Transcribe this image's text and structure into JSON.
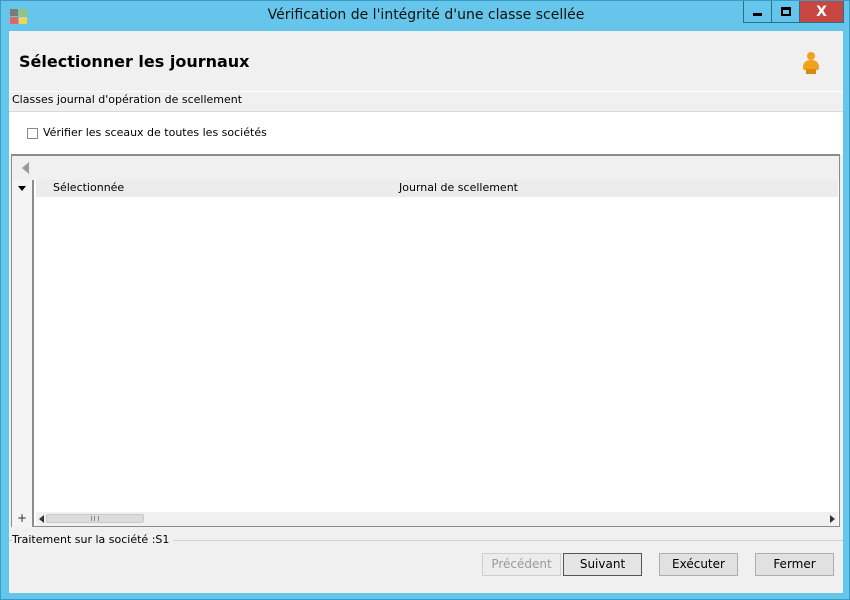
{
  "window": {
    "title": "Vérification de l'intégrité d'une classe scellée",
    "close_glyph": "X"
  },
  "header": {
    "title": "Sélectionner les journaux"
  },
  "group": {
    "label": "Classes journal d'opération de scellement"
  },
  "options": {
    "verify_all_label": "Vérifier les sceaux de toutes les sociétés",
    "verify_all_checked": false
  },
  "grid": {
    "columns": [
      "Sélectionnée",
      "Journal de scellement"
    ],
    "rows": [],
    "add_glyph": "+"
  },
  "status": {
    "text": "Traitement sur la société :S1"
  },
  "buttons": {
    "previous": "Précédent",
    "next": "Suivant",
    "execute": "Exécuter",
    "close": "Fermer"
  },
  "colors": {
    "frame": "#65c5ea",
    "close_button": "#c7463f",
    "user_icon": "#f0a21b"
  }
}
